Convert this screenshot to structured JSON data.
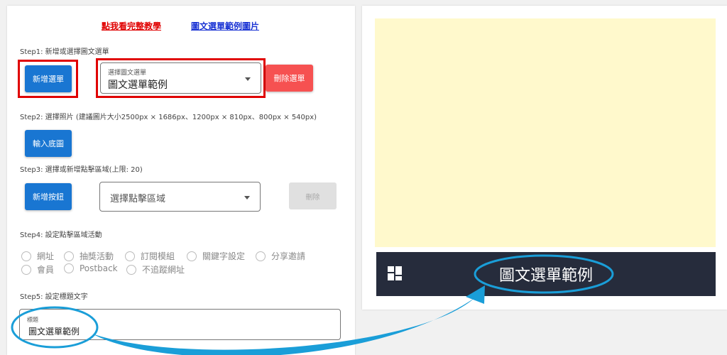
{
  "links": {
    "tutorial": "點我看完整教學",
    "example": "圖文選單範例圖片"
  },
  "step1": {
    "label": "Step1: 新增或選擇圖文選單",
    "add_button": "新增選單",
    "select_label": "選擇圖文選單",
    "select_value": "圖文選單範例",
    "delete_button": "刪除選單"
  },
  "step2": {
    "label": "Step2: 選擇照片 (建議圖片大小2500px × 1686px、1200px × 810px、800px × 540px)",
    "upload_button": "輸入底圖"
  },
  "step3": {
    "label": "Step3: 選擇或新增點擊區域(上限: 20)",
    "add_button": "新增按鈕",
    "select_placeholder": "選擇點擊區域",
    "delete_button": "刪除"
  },
  "step4": {
    "label": "Step4: 設定點擊區域活動",
    "options": [
      "網址",
      "抽獎活動",
      "訂閱模組",
      "關鍵字設定",
      "分享邀請",
      "會員",
      "Postback",
      "不追蹤網址"
    ]
  },
  "step5": {
    "label": "Step5: 設定標題文字",
    "field_label": "標題",
    "field_value": "圖文選單範例"
  },
  "preview": {
    "menu_title": "圖文選單範例",
    "menu_icon": "grid-menu-icon"
  },
  "colors": {
    "primary": "#1976d2",
    "danger": "#f65151",
    "highlight": "#e00000",
    "annotation": "#1a9ed8",
    "preview_bg": "#fff9cc",
    "menu_bar": "#262c3c"
  }
}
